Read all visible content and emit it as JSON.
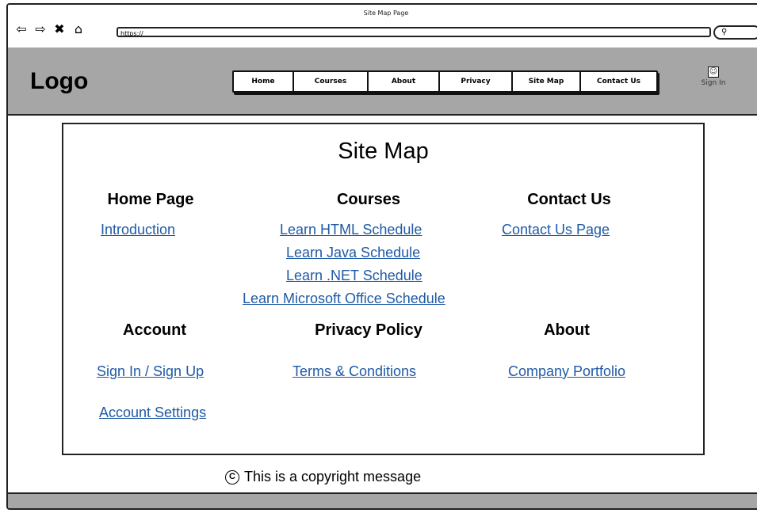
{
  "window": {
    "title": "Site Map Page",
    "url": "https://"
  },
  "nav_icons": [
    "back-arrow-icon",
    "forward-arrow-icon",
    "close-icon",
    "home-icon"
  ],
  "header": {
    "logo": "Logo",
    "nav": [
      "Home",
      "Courses",
      "About",
      "Privacy",
      "Site Map",
      "Contact Us"
    ],
    "sign_in": "Sign In"
  },
  "main": {
    "title": "Site Map",
    "sections": {
      "home": {
        "heading": "Home Page",
        "links": [
          "Introduction"
        ]
      },
      "courses": {
        "heading": "Courses",
        "links": [
          "Learn HTML Schedule",
          "Learn Java Schedule",
          "Learn .NET Schedule",
          "Learn Microsoft Office Schedule"
        ]
      },
      "contact": {
        "heading": "Contact Us",
        "links": [
          "Contact Us Page"
        ]
      },
      "account": {
        "heading": "Account",
        "links": [
          "Sign In / Sign Up",
          "Account Settings"
        ]
      },
      "privacy": {
        "heading": "Privacy Policy",
        "links": [
          "Terms & Conditions"
        ]
      },
      "about": {
        "heading": "About",
        "links": [
          "Company Portfolio"
        ]
      }
    }
  },
  "footer": {
    "copyright": "This is a copyright message"
  }
}
